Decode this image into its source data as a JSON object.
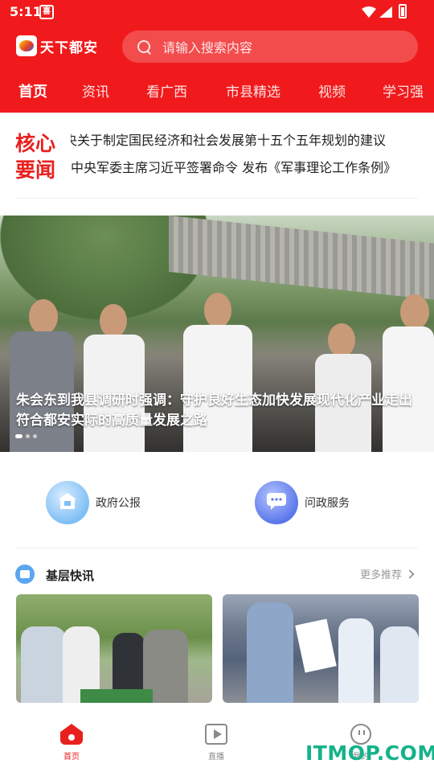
{
  "status_bar": {
    "time": "5:11",
    "notification_badge": "喜"
  },
  "header": {
    "app_name": "天下都安",
    "search_placeholder": "请输入搜索内容",
    "tabs": [
      "首页",
      "资讯",
      "看广西",
      "市县精选",
      "视频",
      "学习强"
    ]
  },
  "core_news": {
    "label": "核心要闻",
    "headlines": [
      "央关于制定国民经济和社会发展第十五个五年规划的建议",
      "中央军委主席习近平签署命令 发布《军事理论工作条例》"
    ]
  },
  "banner": {
    "title": "朱会东到我县调研时强调：守护良好生态加快发展现代化产业走出符合都安实际的高质量发展之路",
    "slide_count": 3,
    "active_slide": 1
  },
  "services": [
    {
      "label": "政府公报",
      "icon": "gov-bulletin-icon"
    },
    {
      "label": "问政服务",
      "icon": "ask-gov-icon"
    }
  ],
  "grassroots": {
    "title": "基层快讯",
    "more": "更多推荐"
  },
  "bottom_nav": [
    {
      "label": "首页",
      "icon": "home-icon",
      "active": true
    },
    {
      "label": "直播",
      "icon": "live-play-icon",
      "active": false
    },
    {
      "label": "我的",
      "icon": "profile-icon",
      "active": false
    }
  ],
  "watermark": "ITMOP.COM",
  "colors": {
    "brand_red": "#f01a1c",
    "accent_red": "#e8201d",
    "link_blue": "#5aa6f0"
  }
}
